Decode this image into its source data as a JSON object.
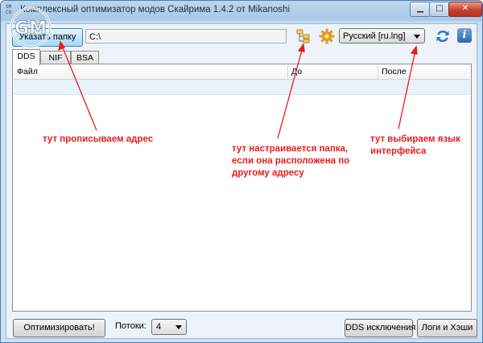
{
  "window": {
    "title": "Комплексный оптимизатор модов Скайрима 1.4.2 от Mikanoshi",
    "app_icon_text": "SM\nCO",
    "minimize_glyph": "▁",
    "maximize_glyph": "□",
    "close_glyph": "✕"
  },
  "toolbar": {
    "select_folder_label": "Указать папку",
    "path_value": "C:\\",
    "language_value": "Русский [ru.lng]",
    "info_glyph": "i",
    "folder_icon": "folder-tree-icon",
    "settings_icon": "gear-icon",
    "refresh_icon": "refresh-icon"
  },
  "tabs": [
    {
      "label": "DDS",
      "active": true
    },
    {
      "label": "NIF",
      "active": false
    },
    {
      "label": "BSA",
      "active": false
    }
  ],
  "table": {
    "columns": [
      "Файл",
      "До",
      "После"
    ]
  },
  "annotations": {
    "address": "тут прописываем адрес",
    "folder": "тут настраивается папка, если она расположена по другому адресу",
    "language": "тут выбираем язык интерфейса",
    "color": "#e41e1e"
  },
  "bottom": {
    "optimize_label": "Оптимизировать!",
    "threads_label": "Потоки:",
    "threads_value": "4",
    "dds_exclusions_label": "DDS исключения",
    "logs_label": "Логи и Хэши"
  },
  "watermark_text": "GM"
}
